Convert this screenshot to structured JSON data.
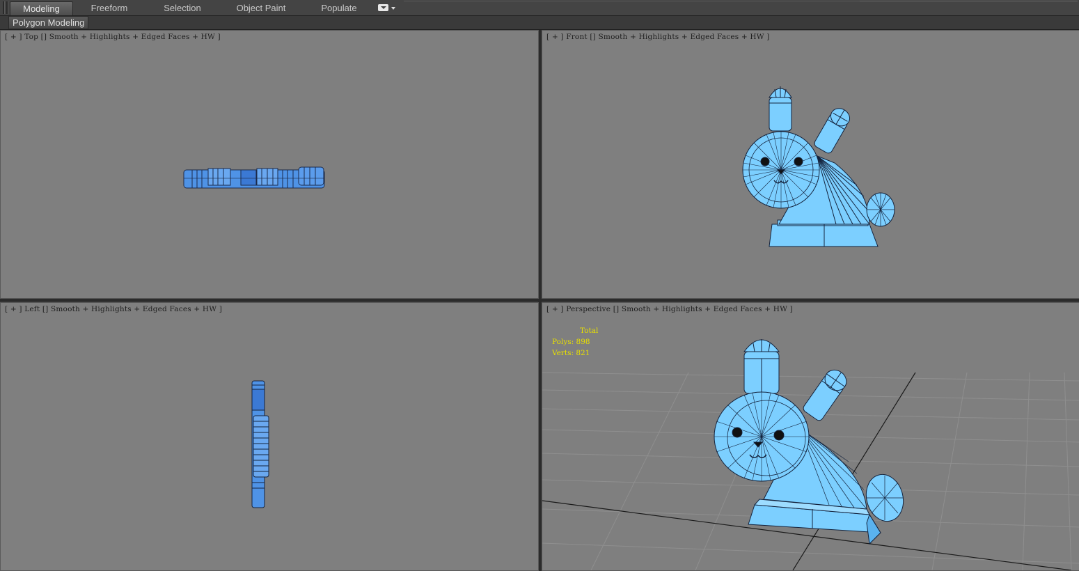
{
  "ribbon": {
    "tabs": [
      "Modeling",
      "Freeform",
      "Selection",
      "Object Paint",
      "Populate"
    ],
    "panel_label": "Polygon Modeling"
  },
  "viewports": {
    "top": {
      "pre": "[ + ]",
      "view": "Top",
      "shading": "Smooth + Highlights + Edged Faces + HW ]"
    },
    "front": {
      "pre": "[ + ]",
      "view": "Front",
      "shading": "Smooth + Highlights + Edged Faces + HW ]"
    },
    "left": {
      "pre": "[ + ]",
      "view": "Left",
      "shading": "Smooth + Highlights + Edged Faces + HW ]"
    },
    "perspective": {
      "pre": "[ + ]",
      "view": "Perspective",
      "shading": "Smooth + Highlights + Edged Faces + HW ]"
    }
  },
  "stats": {
    "total_label": "Total",
    "polys_label": "Polys:",
    "polys_value": "898",
    "verts_label": "Verts:",
    "verts_value": "821"
  },
  "colors": {
    "viewport_bg": "#7f7f7f",
    "model_blue": "#7ccfff",
    "model_dark_blue": "#3f86de",
    "stats_yellow": "#e8e000"
  }
}
